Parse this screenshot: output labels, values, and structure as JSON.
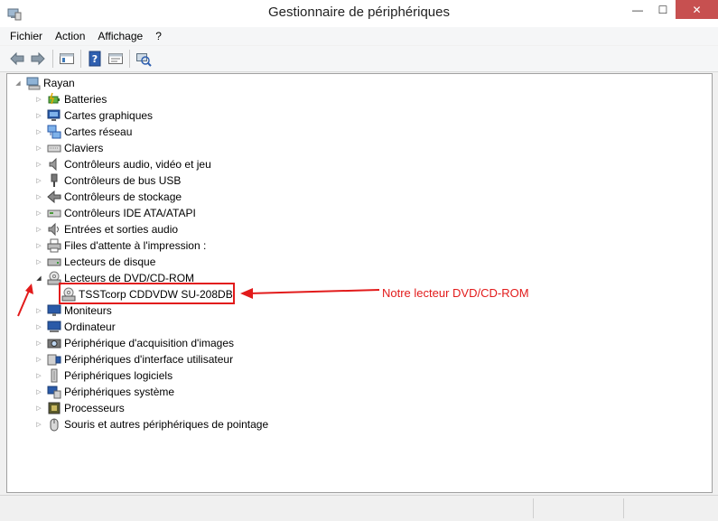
{
  "window": {
    "title": "Gestionnaire de périphériques",
    "minimize": "—",
    "maximize": "☐",
    "close": "✕"
  },
  "menu": [
    "Fichier",
    "Action",
    "Affichage",
    "?"
  ],
  "tree": {
    "root": "Rayan",
    "items": [
      {
        "label": "Batteries",
        "expanded": false
      },
      {
        "label": "Cartes graphiques",
        "expanded": false
      },
      {
        "label": "Cartes réseau",
        "expanded": false
      },
      {
        "label": "Claviers",
        "expanded": false
      },
      {
        "label": "Contrôleurs audio, vidéo et jeu",
        "expanded": false
      },
      {
        "label": "Contrôleurs de bus USB",
        "expanded": false
      },
      {
        "label": "Contrôleurs de stockage",
        "expanded": false
      },
      {
        "label": "Contrôleurs IDE ATA/ATAPI",
        "expanded": false
      },
      {
        "label": "Entrées et sorties audio",
        "expanded": false
      },
      {
        "label": "Files d'attente à l'impression :",
        "expanded": false
      },
      {
        "label": "Lecteurs de disque",
        "expanded": false
      },
      {
        "label": "Lecteurs de DVD/CD-ROM",
        "expanded": true
      },
      {
        "label": "TSSTcorp CDDVDW SU-208DB",
        "child": true
      },
      {
        "label": "Moniteurs",
        "expanded": false
      },
      {
        "label": "Ordinateur",
        "expanded": false
      },
      {
        "label": "Périphérique d'acquisition d'images",
        "expanded": false
      },
      {
        "label": "Périphériques d'interface utilisateur",
        "expanded": false
      },
      {
        "label": "Périphériques logiciels",
        "expanded": false
      },
      {
        "label": "Périphériques système",
        "expanded": false
      },
      {
        "label": "Processeurs",
        "expanded": false
      },
      {
        "label": "Souris et autres périphériques de pointage",
        "expanded": false
      }
    ]
  },
  "annotation": {
    "text": "Notre lecteur DVD/CD-ROM",
    "color": "#e21b1b"
  },
  "icons": [
    "computer-icon",
    "battery-icon",
    "display-adapter-icon",
    "network-adapter-icon",
    "keyboard-icon",
    "audio-controller-icon",
    "usb-controller-icon",
    "storage-controller-icon",
    "ide-controller-icon",
    "audio-io-icon",
    "print-queue-icon",
    "disk-drive-icon",
    "dvd-drive-icon",
    "dvd-device-icon",
    "monitor-icon",
    "computer-icon",
    "imaging-device-icon",
    "hid-icon",
    "software-device-icon",
    "system-device-icon",
    "processor-icon",
    "mouse-icon"
  ]
}
